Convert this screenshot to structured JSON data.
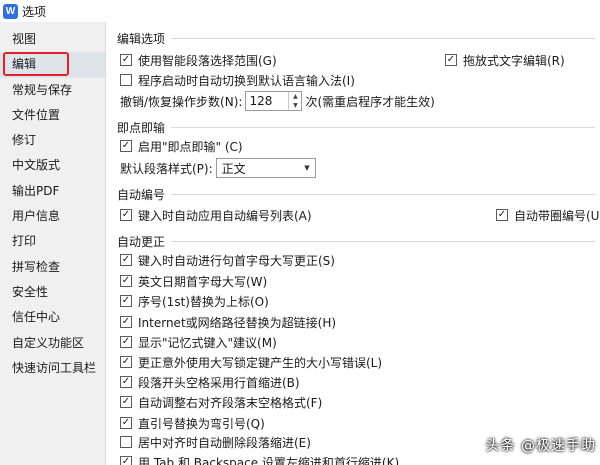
{
  "window": {
    "title": "选项",
    "icon_letter": "W"
  },
  "sidebar": {
    "items": [
      {
        "label": "视图"
      },
      {
        "label": "编辑"
      },
      {
        "label": "常规与保存"
      },
      {
        "label": "文件位置"
      },
      {
        "label": "修订"
      },
      {
        "label": "中文版式"
      },
      {
        "label": "输出PDF"
      },
      {
        "label": "用户信息"
      },
      {
        "label": "打印"
      },
      {
        "label": "拼写检查"
      },
      {
        "label": "安全性"
      },
      {
        "label": "信任中心"
      },
      {
        "label": "自定义功能区"
      },
      {
        "label": "快速访问工具栏"
      }
    ],
    "selected": "编辑"
  },
  "edit_options": {
    "title": "编辑选项",
    "smart_select": {
      "label": "使用智能段落选择范围(G)",
      "checked": true
    },
    "drag_drop": {
      "label": "拖放式文字编辑(R)",
      "checked": true
    },
    "auto_ime": {
      "label": "程序启动时自动切换到默认语言输入法(I)",
      "checked": false
    },
    "undo_steps": {
      "label": "撤销/恢复操作步数(N):",
      "value": "128",
      "note": "次(需重启程序才能生效)"
    }
  },
  "click_and_type": {
    "title": "即点即输",
    "enable": {
      "label": "启用\"即点即输\" (C)",
      "checked": true
    },
    "default_style": {
      "label": "默认段落样式(P):",
      "value": "正文"
    }
  },
  "auto_numbering": {
    "title": "自动编号",
    "auto_list": {
      "label": "键入时自动应用自动编号列表(A)",
      "checked": true
    },
    "auto_circle": {
      "label": "自动带圈编号(U)",
      "checked": true
    }
  },
  "autocorrect": {
    "title": "自动更正",
    "items": [
      {
        "label": "键入时自动进行句首字母大写更正(S)",
        "checked": true
      },
      {
        "label": "英文日期首字母大写(W)",
        "checked": true
      },
      {
        "label": "序号(1st)替换为上标(O)",
        "checked": true
      },
      {
        "label": "Internet或网络路径替换为超链接(H)",
        "checked": true
      },
      {
        "label": "显示\"记忆式键入\"建议(M)",
        "checked": true
      },
      {
        "label": "更正意外使用大写锁定键产生的大小写错误(L)",
        "checked": true
      },
      {
        "label": "段落开头空格采用行首缩进(B)",
        "checked": true
      },
      {
        "label": "自动调整右对齐段落末空格格式(F)",
        "checked": true
      },
      {
        "label": "直引号替换为弯引号(Q)",
        "checked": true
      },
      {
        "label": "居中对齐时自动删除段落缩进(E)",
        "checked": false
      },
      {
        "label": "用 Tab 和 Backspace 设置左缩进和首行缩进(K)",
        "checked": true
      }
    ]
  },
  "watermark": {
    "text": "头条 @极速手助"
  },
  "colors": {
    "highlight_border": "#e0202a",
    "app_icon": "#2f6fe0"
  }
}
